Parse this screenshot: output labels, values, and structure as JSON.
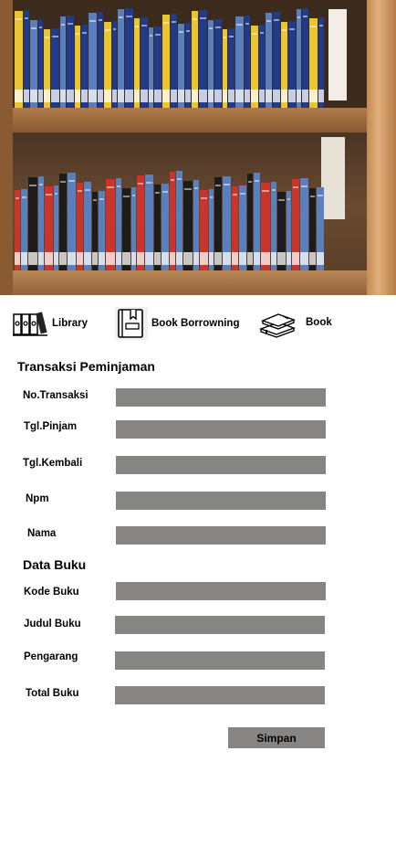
{
  "nav": {
    "items": [
      {
        "label": "Library",
        "icon": "books-icon"
      },
      {
        "label": "Book Borrowning",
        "icon": "book-bookmark-icon"
      },
      {
        "label": "Book",
        "icon": "book-stack-icon"
      }
    ]
  },
  "transaction": {
    "title": "Transaksi Peminjaman",
    "fields": [
      {
        "label": "No.Transaksi",
        "value": ""
      },
      {
        "label": "Tgl.Pinjam",
        "value": ""
      },
      {
        "label": "Tgl.Kembali",
        "value": ""
      },
      {
        "label": "Npm",
        "value": ""
      },
      {
        "label": "Nama",
        "value": ""
      }
    ]
  },
  "book_data": {
    "title": "Data Buku",
    "fields": [
      {
        "label": "Kode Buku",
        "value": ""
      },
      {
        "label": "Judul Buku",
        "value": ""
      },
      {
        "label": "Pengarang",
        "value": ""
      },
      {
        "label": "Total Buku",
        "value": ""
      }
    ]
  },
  "actions": {
    "save_label": "Simpan"
  },
  "colors": {
    "input_fill": "#878484",
    "background": "#ffffff"
  }
}
